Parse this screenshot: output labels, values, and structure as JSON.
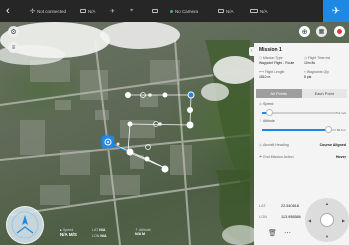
{
  "status_bar": {
    "connection_text": "Not connected",
    "signal_value": "N/A",
    "camera_text": "No Camera",
    "storage_value": "N/A",
    "battery_value": "N/A",
    "mode_icon": "plane-icon",
    "accent_color": "#1e88e5"
  },
  "panel": {
    "title": "Mission 1",
    "mission_type_label": "Mission Type",
    "mission_type_value": "Waypoint Flight - Route",
    "flight_time_label": "Flight Time est.",
    "flight_time_value": "10m 8s",
    "flight_length_label": "Flight Length",
    "flight_length_value": "1810 m",
    "waypoints_label": "Waypoints Qty",
    "waypoints_value": "8 pts",
    "tabs": [
      "All Points",
      "Each Point"
    ],
    "active_tab": "All Points",
    "speed_label": "Speed",
    "speed_value": "5.0 m/s",
    "speed_level": 0.1,
    "altitude_label": "Altitude",
    "altitude_value": "50.0 m",
    "altitude_level": 0.9,
    "heading_label": "Aircraft Heading",
    "heading_value": "Course Aligned",
    "end_action_label": "End Mission Action",
    "end_action_value": "Hover",
    "lat_label": "LAT",
    "lat_value": "22.540818",
    "lon_label": "LON",
    "lon_value": "113.958586"
  },
  "telemetry": {
    "speed_label": "Speed",
    "speed_value": "N/A M/S",
    "lat_label": "LAT",
    "lat_value": "N/A",
    "lon_label": "LON",
    "lon_value": "N/A",
    "alt_label": "Altitude",
    "alt_value": "N/A M"
  }
}
